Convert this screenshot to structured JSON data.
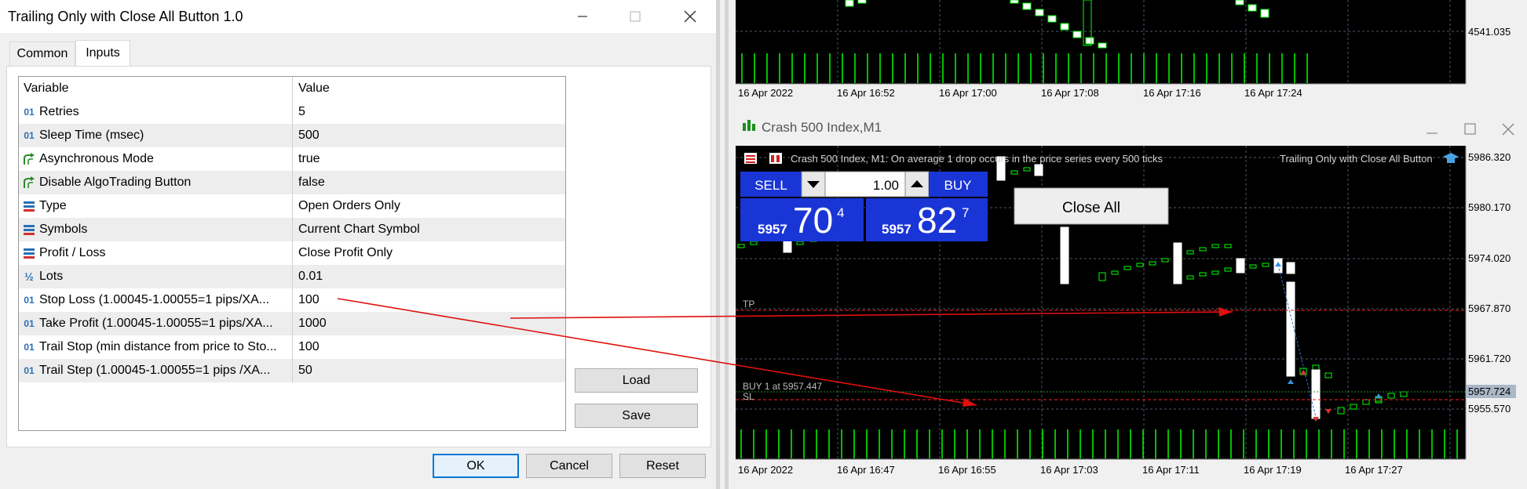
{
  "dialog": {
    "title": "Trailing Only with Close All Button 1.0",
    "tabs": [
      "Common",
      "Inputs"
    ],
    "active_tab": "Inputs",
    "headers": {
      "variable": "Variable",
      "value": "Value"
    },
    "rows": [
      {
        "icon": "int",
        "variable": "Retries",
        "value": "5"
      },
      {
        "icon": "int",
        "variable": "Sleep Time (msec)",
        "value": "500"
      },
      {
        "icon": "bool",
        "variable": "Asynchronous Mode",
        "value": "true"
      },
      {
        "icon": "bool",
        "variable": "Disable AlgoTrading Button",
        "value": "false"
      },
      {
        "icon": "enum",
        "variable": "Type",
        "value": "Open Orders Only"
      },
      {
        "icon": "enum",
        "variable": "Symbols",
        "value": "Current Chart Symbol"
      },
      {
        "icon": "enum",
        "variable": "Profit / Loss",
        "value": "Close Profit Only"
      },
      {
        "icon": "double",
        "variable": "Lots",
        "value": "0.01"
      },
      {
        "icon": "int",
        "variable": "Stop Loss (1.00045-1.00055=1 pips/XA...",
        "value": "100"
      },
      {
        "icon": "int",
        "variable": "Take Profit (1.00045-1.00055=1 pips/XA...",
        "value": "1000"
      },
      {
        "icon": "int",
        "variable": "Trail Stop (min distance from price to Sto...",
        "value": "100"
      },
      {
        "icon": "int",
        "variable": "Trail Step (1.00045-1.00055=1 pips /XA...",
        "value": "50"
      }
    ],
    "buttons": {
      "load": "Load",
      "save": "Save",
      "ok": "OK",
      "cancel": "Cancel",
      "reset": "Reset"
    },
    "icon_glyphs": {
      "int": "01",
      "double": "½"
    }
  },
  "top_chart": {
    "price_label": "4541.035",
    "time_labels": [
      "16 Apr 2022",
      "16 Apr 16:52",
      "16 Apr 17:00",
      "16 Apr 17:08",
      "16 Apr 17:16",
      "16 Apr 17:24"
    ]
  },
  "main_chart": {
    "window_title": "Crash 500 Index,M1",
    "info_text": "Crash 500 Index, M1:  On average 1 drop occurs in the price series every 500 ticks",
    "ea_name": "Trailing Only with Close All Button",
    "sell_label": "SELL",
    "buy_label": "BUY",
    "lot_value": "1.00",
    "sell_price_small": "5957",
    "sell_price_big": "70",
    "sell_price_sup": "4",
    "buy_price_small": "5957",
    "buy_price_big": "82",
    "buy_price_sup": "7",
    "close_all_label": "Close All",
    "tp_label": "TP",
    "sl_label": "SL",
    "position_label": "BUY 1 at 5957.447",
    "current_price": "5957.724",
    "price_labels": [
      "5986.320",
      "5980.170",
      "5974.020",
      "5967.870",
      "5961.720",
      "5955.570"
    ],
    "time_labels": [
      "16 Apr 2022",
      "16 Apr 16:47",
      "16 Apr 16:55",
      "16 Apr 17:03",
      "16 Apr 17:11",
      "16 Apr 17:19",
      "16 Apr 17:27"
    ]
  },
  "colors": {
    "chart_bg": "#000000",
    "grid": "#4a5a6a",
    "bull": "#00ff00",
    "bear_body": "#ffffff",
    "volume": "#00ff00",
    "tp_sl_line": "#ff0000",
    "arrow": "#e01010",
    "sell_panel": "#1a35d6",
    "buy_panel": "#1a35d6"
  }
}
